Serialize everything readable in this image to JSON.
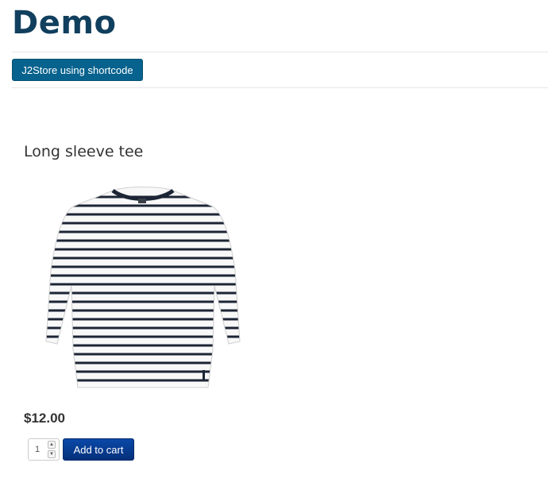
{
  "site": {
    "title": "Demo"
  },
  "menu": {
    "button_label": "J2Store using shortcode"
  },
  "product": {
    "title": "Long sleeve tee",
    "image_icon": "striped-long-sleeve-tee-image",
    "price": "$12.00",
    "quantity": "1",
    "add_to_cart_label": "Add to cart"
  },
  "colors": {
    "title": "#113f5e",
    "menu_button": "#07628d",
    "cart_button": "#04307a"
  }
}
